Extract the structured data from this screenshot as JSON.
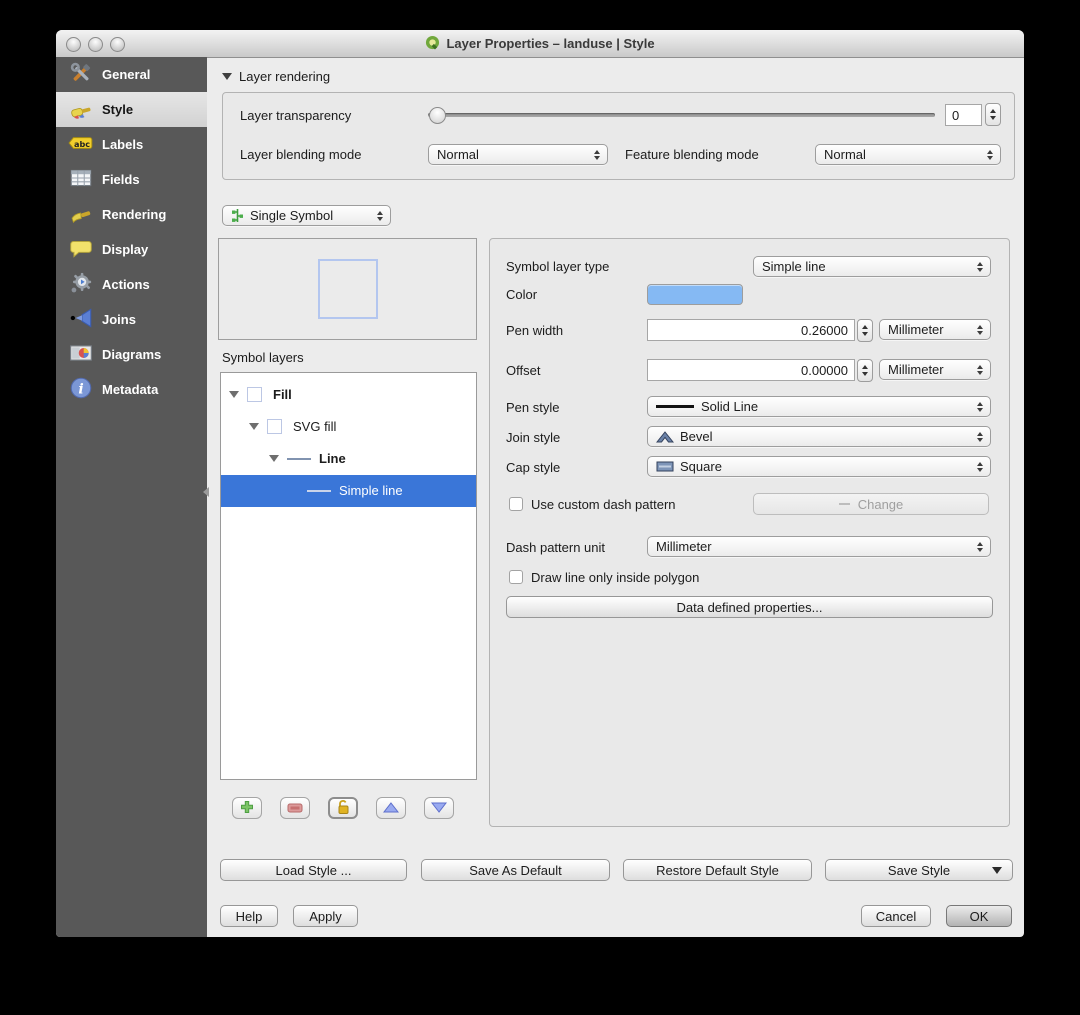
{
  "window": {
    "title": "Layer Properties – landuse | Style"
  },
  "sidebar": {
    "items": [
      {
        "label": "General"
      },
      {
        "label": "Style"
      },
      {
        "label": "Labels"
      },
      {
        "label": "Fields"
      },
      {
        "label": "Rendering"
      },
      {
        "label": "Display"
      },
      {
        "label": "Actions"
      },
      {
        "label": "Joins"
      },
      {
        "label": "Diagrams"
      },
      {
        "label": "Metadata"
      }
    ]
  },
  "layer_rendering": {
    "section_label": "Layer rendering",
    "transparency_label": "Layer transparency",
    "transparency_value": "0",
    "layer_blending_label": "Layer blending mode",
    "layer_blending_value": "Normal",
    "feature_blending_label": "Feature blending mode",
    "feature_blending_value": "Normal"
  },
  "renderer": {
    "selected": "Single Symbol"
  },
  "symbol_layers": {
    "section_label": "Symbol layers",
    "tree": [
      {
        "label": "Fill"
      },
      {
        "label": "SVG fill"
      },
      {
        "label": "Line"
      },
      {
        "label": "Simple line"
      }
    ]
  },
  "properties": {
    "symbol_layer_type": {
      "label": "Symbol layer type",
      "value": "Simple line"
    },
    "color": {
      "label": "Color",
      "value": "#85b9f3"
    },
    "pen_width": {
      "label": "Pen width",
      "value": "0.26000",
      "unit": "Millimeter"
    },
    "offset": {
      "label": "Offset",
      "value": "0.00000",
      "unit": "Millimeter"
    },
    "pen_style": {
      "label": "Pen style",
      "value": "Solid Line"
    },
    "join_style": {
      "label": "Join style",
      "value": "Bevel"
    },
    "cap_style": {
      "label": "Cap style",
      "value": "Square"
    },
    "custom_dash": {
      "label": "Use custom dash pattern",
      "button": "Change"
    },
    "dash_pattern_unit": {
      "label": "Dash pattern unit",
      "value": "Millimeter"
    },
    "draw_inside": {
      "label": "Draw line only inside polygon"
    },
    "data_defined": {
      "label": "Data defined properties..."
    }
  },
  "style_buttons": {
    "load_style": "Load Style ...",
    "save_as_default": "Save As Default",
    "restore_default": "Restore Default Style",
    "save_style": "Save Style"
  },
  "dialog_buttons": {
    "help": "Help",
    "apply": "Apply",
    "cancel": "Cancel",
    "ok": "OK"
  }
}
